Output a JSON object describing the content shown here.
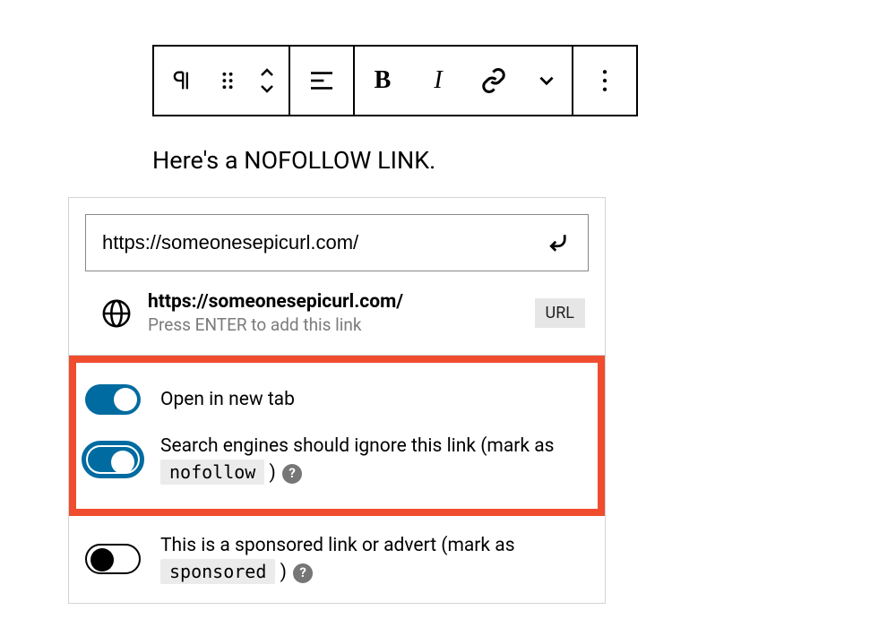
{
  "content": {
    "paragraph": "Here's a NOFOLLOW LINK."
  },
  "toolbar": {
    "icons": {
      "paragraph": "paragraph-icon",
      "drag": "drag-icon",
      "move": "move-icon",
      "align": "align-left-icon",
      "bold": "B",
      "italic": "I",
      "link": "link-icon",
      "more_rich": "chevron-down-icon",
      "options": "more-vertical-icon"
    }
  },
  "link_popover": {
    "input_value": "https://someonesepicurl.com/",
    "submit_icon": "enter-icon",
    "suggestion": {
      "icon": "globe-icon",
      "url": "https://someonesepicurl.com/",
      "hint": "Press ENTER to add this link",
      "badge": "URL"
    },
    "toggles": [
      {
        "id": "open_new_tab",
        "label": "Open in new tab",
        "state": "on"
      },
      {
        "id": "nofollow",
        "label_pre": "Search engines should ignore this link (mark as ",
        "code": "nofollow",
        "label_post": " ) ",
        "help": "?",
        "state": "on"
      },
      {
        "id": "sponsored",
        "label_pre": "This is a sponsored link or advert (mark as ",
        "code": "sponsored",
        "label_post": " ) ",
        "help": "?",
        "state": "off"
      }
    ]
  }
}
